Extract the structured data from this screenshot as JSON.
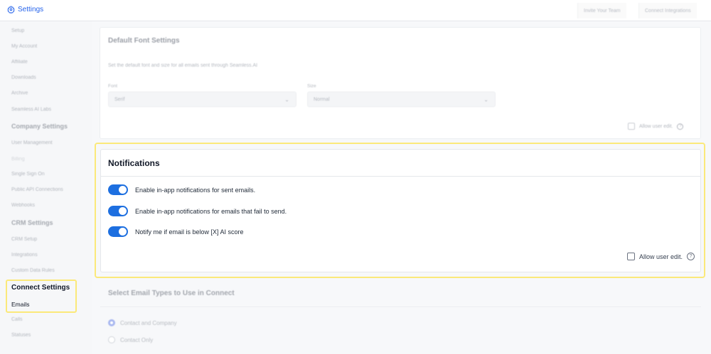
{
  "topbar": {
    "brand": "Settings",
    "invite_btn": "Invite Your Team",
    "connect_btn": "Connect Integrations"
  },
  "sidebar": {
    "setup": "Setup",
    "my_account": "My Account",
    "affiliate": "Affiliate",
    "downloads": "Downloads",
    "archive": "Archive",
    "labs": "Seamless AI Labs",
    "company_heading": "Company Settings",
    "user_management": "User Management",
    "billing": "Billing",
    "sso": "Single Sign On",
    "public_api": "Public API Connections",
    "webhooks": "Webhooks",
    "crm_heading": "CRM Settings",
    "crm_setup": "CRM Setup",
    "integrations": "Integrations",
    "custom_rules": "Custom Data Rules",
    "connect_heading": "Connect Settings",
    "emails": "Emails",
    "calls": "Calls",
    "statuses": "Statuses"
  },
  "font_settings": {
    "title": "Default Font Settings",
    "description": "Set the default font and size for all emails sent through Seamless.AI",
    "font_label": "Font",
    "font_value": "Serif",
    "size_label": "Size",
    "size_value": "Normal",
    "allow_label": "Allow user edit."
  },
  "notifications": {
    "title": "Notifications",
    "toggles": [
      {
        "label": "Enable in-app notifications for sent emails.",
        "on": true
      },
      {
        "label": "Enable in-app notifications for emails that fail to send.",
        "on": true
      },
      {
        "label": "Notify me if email is below [X] AI score",
        "on": true
      }
    ],
    "allow_label": "Allow user edit."
  },
  "email_types": {
    "title": "Select Email Types to Use in Connect",
    "options": [
      "Contact and Company",
      "Contact Only"
    ]
  },
  "colors": {
    "accent": "#1d6fe0",
    "highlight": "#fbe97a"
  }
}
